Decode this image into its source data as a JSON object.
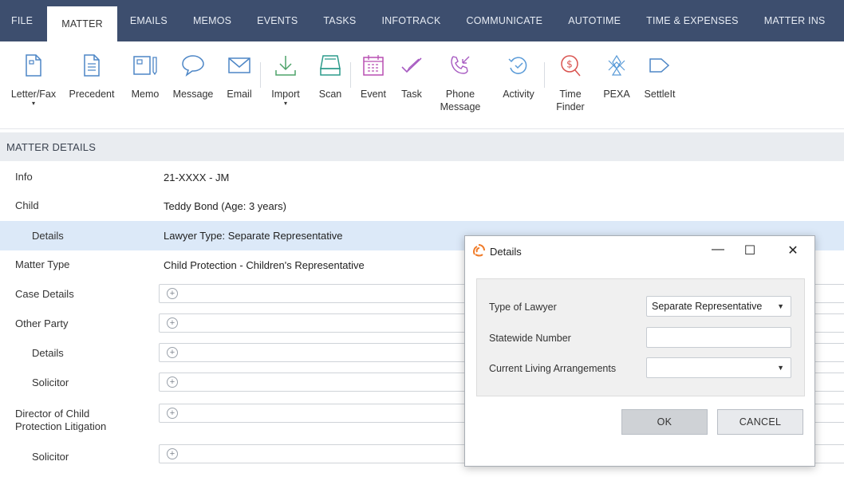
{
  "tabs": [
    "FILE",
    "MATTER",
    "EMAILS",
    "MEMOS",
    "EVENTS",
    "TASKS",
    "INFOTRACK",
    "COMMUNICATE",
    "AUTOTIME",
    "TIME & EXPENSES",
    "MATTER INS"
  ],
  "active_tab": "MATTER",
  "ribbon": {
    "letter_fax": "Letter/Fax",
    "precedent": "Precedent",
    "memo": "Memo",
    "message": "Message",
    "email": "Email",
    "import": "Import",
    "scan": "Scan",
    "event": "Event",
    "task": "Task",
    "phone_message_1": "Phone",
    "phone_message_2": "Message",
    "activity": "Activity",
    "time_finder_1": "Time",
    "time_finder_2": "Finder",
    "pexa": "PEXA",
    "settleit": "SettleIt",
    "caret": "▾"
  },
  "section": {
    "title": "MATTER DETAILS"
  },
  "rows": {
    "info": {
      "label": "Info",
      "value": "21-XXXX - JM"
    },
    "child": {
      "label": "Child",
      "value": "Teddy Bond (Age: 3 years)"
    },
    "details": {
      "label": "Details",
      "value": "Lawyer Type: Separate Representative"
    },
    "matter_type": {
      "label": "Matter Type",
      "value": "Child Protection - Children's Representative"
    },
    "case_details": {
      "label": "Case Details"
    },
    "other_party": {
      "label": "Other Party"
    },
    "op_details": {
      "label": "Details"
    },
    "op_solicitor": {
      "label": "Solicitor"
    },
    "director_1": {
      "label": "Director of Child"
    },
    "director_2": {
      "label": "Protection Litigation"
    },
    "dir_solicitor": {
      "label": "Solicitor"
    }
  },
  "plus_glyph": "+",
  "dialog": {
    "title": "Details",
    "minimize": "—",
    "maximize": "☐",
    "close": "✕",
    "type_of_lawyer_label": "Type of Lawyer",
    "type_of_lawyer_value": "Separate Representative",
    "statewide_number_label": "Statewide Number",
    "statewide_number_value": "",
    "living_arrangements_label": "Current Living Arrangements",
    "living_arrangements_value": "",
    "ok": "OK",
    "cancel": "CANCEL",
    "dropdown_arrow": "▼"
  },
  "colors": {
    "tabbar": "#3d4e6e",
    "icon": "#4d86c6",
    "event_icon": "#b84fb2",
    "task_icon": "#a85cc2",
    "activity_icon": "#5a9bd8",
    "timefinder_icon": "#d9534f",
    "scan_icon": "#2c9b8b",
    "import_icon": "#4fa36a",
    "highlight_row": "#dce9f8",
    "logo": "#f07c2a"
  }
}
